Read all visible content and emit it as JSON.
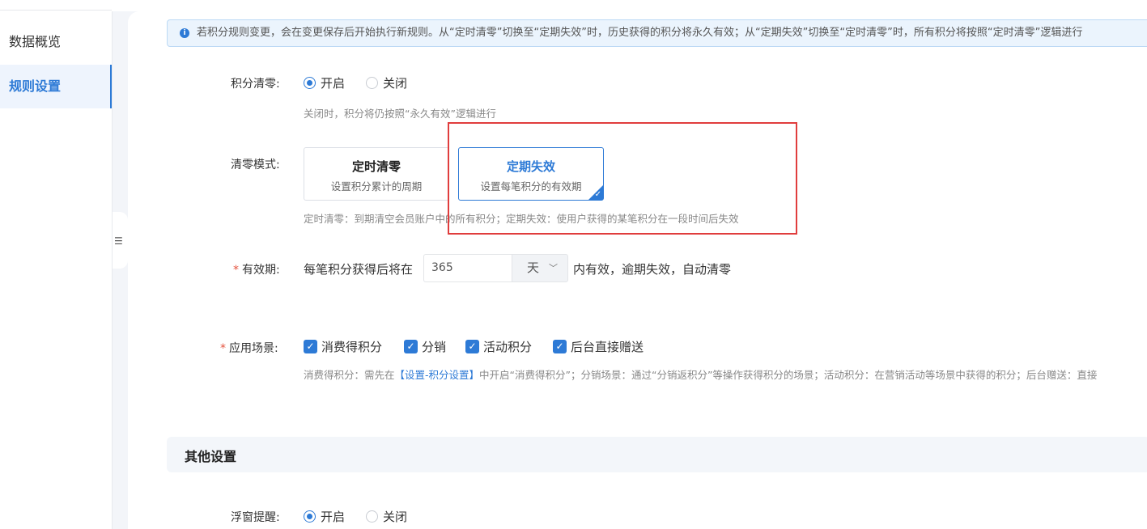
{
  "sidebar": {
    "items": [
      {
        "label": "数据概览"
      },
      {
        "label": "规则设置"
      }
    ]
  },
  "notice": {
    "icon": "info-icon",
    "text": "若积分规则变更，会在变更保存后开始执行新规则。从“定时清零”切换至“定期失效”时，历史获得的积分将永久有效；从“定期失效”切换至“定时清零”时，所有积分将按照“定时清零”逻辑进行"
  },
  "clear": {
    "label": "积分清零:",
    "options": [
      {
        "label": "开启",
        "checked": true
      },
      {
        "label": "关闭",
        "checked": false
      }
    ],
    "hint": "关闭时，积分将仍按照“永久有效”逻辑进行"
  },
  "mode": {
    "label": "清零模式:",
    "cards": [
      {
        "title": "定时清零",
        "desc": "设置积分累计的周期",
        "selected": false
      },
      {
        "title": "定期失效",
        "desc": "设置每笔积分的有效期",
        "selected": true
      }
    ],
    "hint": "定时清零：到期清空会员账户中的所有积分；定期失效：使用户获得的某笔积分在一段时间后失效"
  },
  "validity": {
    "required": "*",
    "label": "有效期:",
    "prefix": "每笔积分获得后将在",
    "value": "365",
    "unit": "天",
    "suffix": "内有效，逾期失效，自动清零"
  },
  "scene": {
    "required": "*",
    "label": "应用场景:",
    "options": [
      {
        "label": "消费得积分",
        "checked": true
      },
      {
        "label": "分销",
        "checked": true
      },
      {
        "label": "活动积分",
        "checked": true
      },
      {
        "label": "后台直接赠送",
        "checked": true
      }
    ],
    "hint_pre": "消费得积分：需先在",
    "hint_link": "【设置-积分设置】",
    "hint_post": "中开启“消费得积分”；分销场景：通过“分销返积分”等操作获得积分的场景；活动积分：在营销活动等场景中获得的积分；后台赠送：直接"
  },
  "other": {
    "title": "其他设置",
    "float_label": "浮窗提醒:",
    "float_options": [
      {
        "label": "开启",
        "checked": true
      },
      {
        "label": "关闭",
        "checked": false
      }
    ]
  },
  "colors": {
    "accent": "#2d7ad6",
    "highlight": "#e03d3d"
  }
}
